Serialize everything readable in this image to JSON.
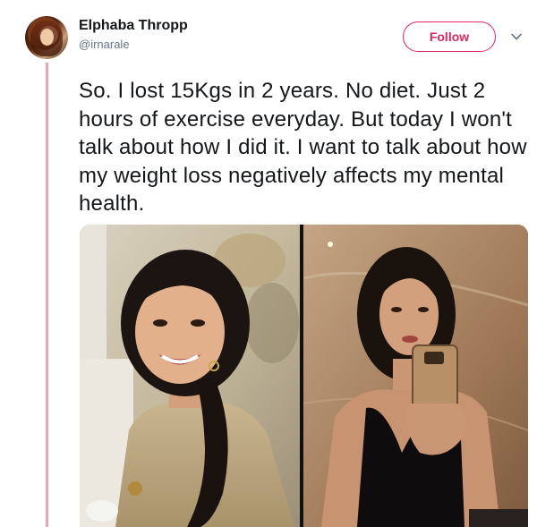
{
  "tweet": {
    "author_name": "Elphaba Thropp",
    "author_handle": "@irnarale",
    "follow_label": "Follow",
    "text": "So. I lost 15Kgs in 2 years. No diet. Just 2 hours of exercise everyday. But today I won't talk about how I did it. I want to talk about how my weight loss negatively affects my mental health."
  },
  "icons": {
    "avatar": "avatar-photo",
    "caret": "chevron-down-icon"
  },
  "colors": {
    "accent": "#e0245e",
    "thread_line": "#e9a7a5",
    "text": "#14171a",
    "secondary_text": "#657786"
  }
}
